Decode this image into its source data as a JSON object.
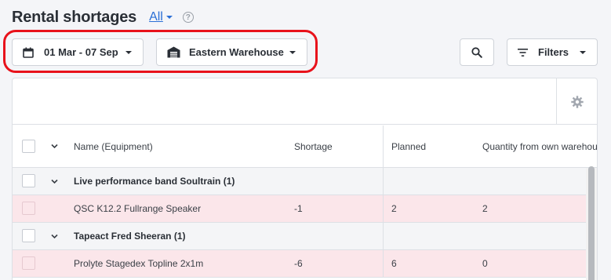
{
  "header": {
    "title": "Rental shortages",
    "scope_filter": "All",
    "help_icon": "question-circle-icon"
  },
  "filters": {
    "date_range": "01 Mar - 07 Sep",
    "warehouse": "Eastern Warehouse",
    "filters_label": "Filters"
  },
  "colors": {
    "highlight": "#e8121b",
    "shortage_row": "#fbe6ea",
    "link": "#2a6fd6"
  },
  "table": {
    "columns": [
      "Name (Equipment)",
      "Shortage",
      "Planned",
      "Quantity from own warehouse"
    ],
    "groups": [
      {
        "name": "Live performance band Soultrain (1)",
        "items": [
          {
            "name": "QSC K12.2 Fullrange Speaker",
            "shortage": "-1",
            "planned": "2",
            "own_qty": "2"
          }
        ]
      },
      {
        "name": "Tapeact Fred Sheeran (1)",
        "items": [
          {
            "name": "Prolyte Stagedex Topline 2x1m",
            "shortage": "-6",
            "planned": "6",
            "own_qty": "0"
          }
        ]
      }
    ]
  }
}
